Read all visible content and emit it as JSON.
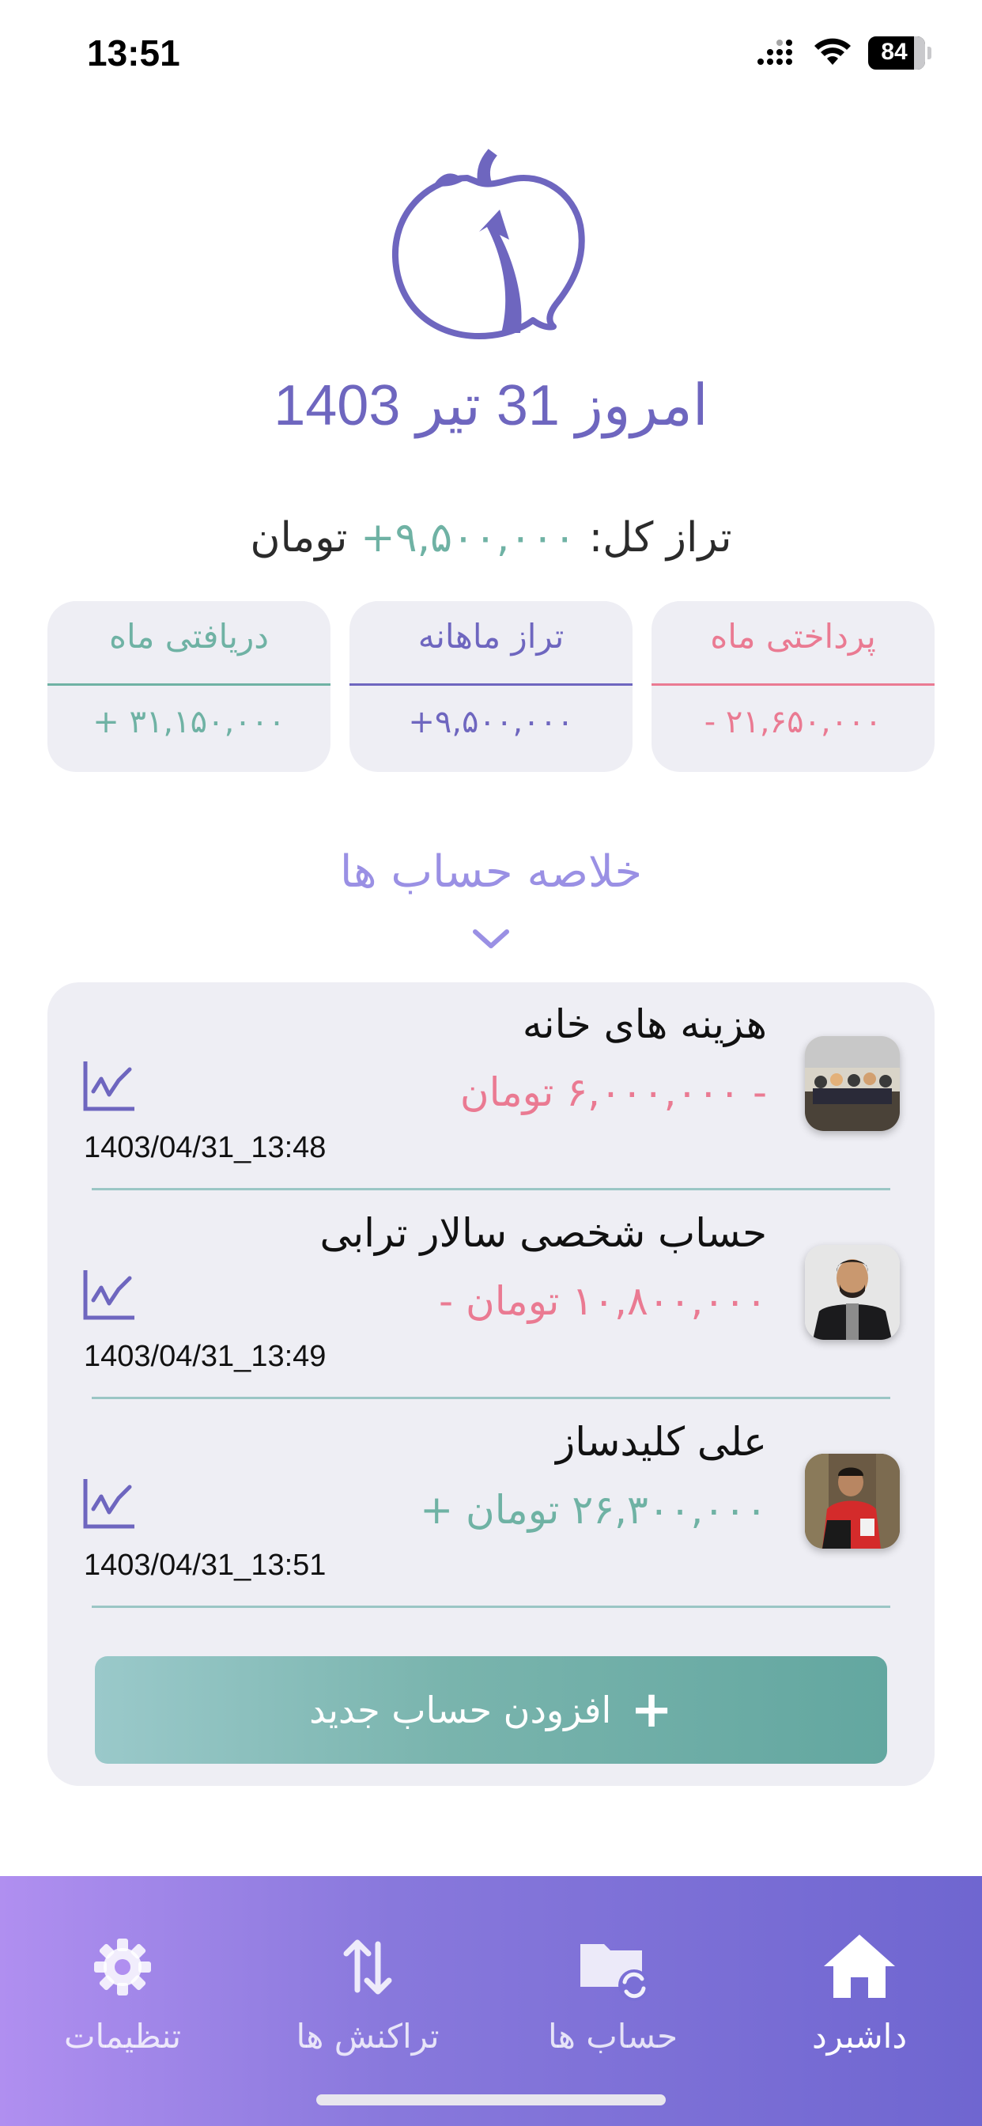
{
  "status_bar": {
    "time": "13:51",
    "battery": "84",
    "icons": [
      "signal-icon",
      "wifi-icon",
      "battery-icon"
    ]
  },
  "header": {
    "logo_icon": "apple-arrow-logo-icon",
    "date_title": "امروز 31 تیر 1403"
  },
  "total": {
    "label": "تراز کل:",
    "amount": "+۹,۵۰۰,۰۰۰",
    "currency": "تومان"
  },
  "cards": {
    "received": {
      "title": "دریافتی ماه",
      "value": "+ ۳۱,۱۵۰,۰۰۰",
      "color": "#6fb2a4"
    },
    "monthly": {
      "title": "تراز ماهانه",
      "value": "+۹,۵۰۰,۰۰۰",
      "color": "#6e66bf"
    },
    "paid": {
      "title": "پرداختی ماه",
      "value": "- ۲۱,۶۵۰,۰۰۰",
      "color": "#ea7a92"
    }
  },
  "accounts_section": {
    "title": "خلاصه حساب ها",
    "chevron_icon": "chevron-down-icon",
    "items": [
      {
        "name": "هزینه های خانه",
        "amount": "- ۶,۰۰۰,۰۰۰ تومان",
        "sign": "negative",
        "timestamp": "1403/04/31_13:48",
        "chart_icon": "line-chart-icon"
      },
      {
        "name": "حساب شخصی سالار ترابی",
        "amount": "۱۰,۸۰۰,۰۰۰ تومان -",
        "sign": "negative",
        "timestamp": "1403/04/31_13:49",
        "chart_icon": "line-chart-icon"
      },
      {
        "name": "علی کلیدساز",
        "amount": "۲۶,۳۰۰,۰۰۰ تومان +",
        "sign": "positive",
        "timestamp": "1403/04/31_13:51",
        "chart_icon": "line-chart-icon"
      }
    ],
    "add_button": "افزودن حساب جدید"
  },
  "bottom_nav": {
    "items": [
      {
        "label": "تنظیمات",
        "icon": "gear-icon",
        "active": false
      },
      {
        "label": "تراکنش ها",
        "icon": "transfer-arrows-icon",
        "active": false
      },
      {
        "label": "حساب ها",
        "icon": "folder-sync-icon",
        "active": false
      },
      {
        "label": "داشبرد",
        "icon": "home-icon",
        "active": true
      }
    ]
  },
  "colors": {
    "accent": "#6e66bf",
    "positive": "#6fb2a4",
    "negative": "#ea7a92",
    "panel": "#eeeef4"
  }
}
